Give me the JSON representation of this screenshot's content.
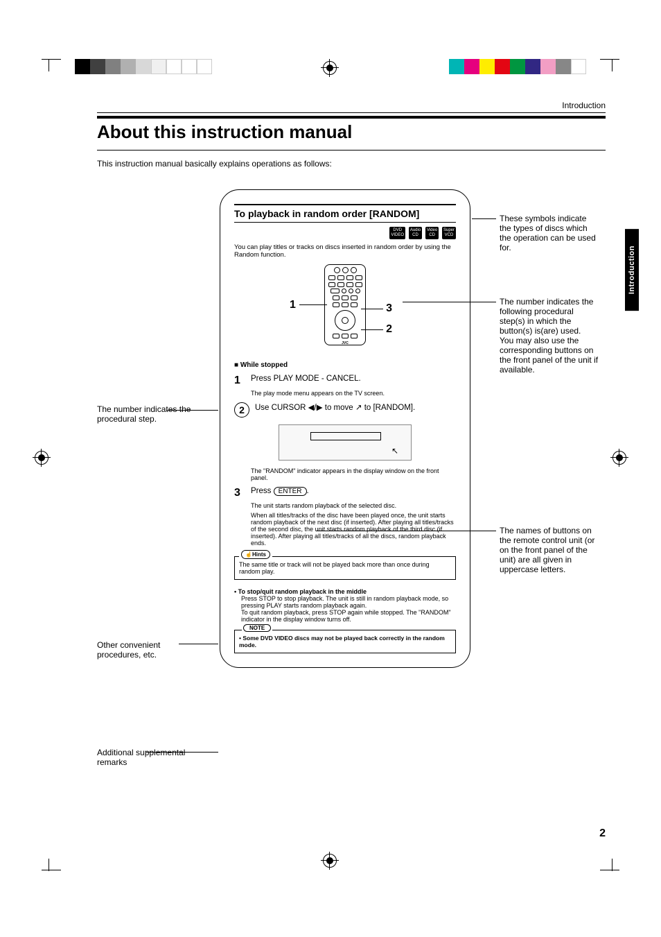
{
  "header": {
    "section": "Introduction"
  },
  "title": "About this instruction manual",
  "intro": "This instruction manual basically explains operations as follows:",
  "side_tab": "Introduction",
  "page_number": "2",
  "example": {
    "title": "To playback in random order [RANDOM]",
    "disc_symbols": [
      "DVD\nVIDEO",
      "Audio\nCD",
      "Video\nCD",
      "Super\nVCD"
    ],
    "desc": "You can play titles or tracks on discs inserted in random order by using the Random function.",
    "remote_brand": "JVC",
    "callouts": {
      "one": "1",
      "two": "2",
      "three": "3"
    },
    "while_stopped": "■ While stopped",
    "step1": {
      "num": "1",
      "text": "Press PLAY MODE - CANCEL.",
      "note": "The play mode menu appears on the TV screen."
    },
    "step2": {
      "num_circled": "2",
      "text_before": "Use CURSOR ◀/▶ to move ",
      "cursor_icon": "↖",
      "text_after": " to [RANDOM].",
      "result": "The \"RANDOM\" indicator appears in the display window on the front panel."
    },
    "step3": {
      "num": "3",
      "press": "Press",
      "button": "ENTER",
      "after": ".",
      "note1": "The unit starts random playback of the selected disc.",
      "note2": "When all titles/tracks of the disc have been played once, the unit starts random playback of the next disc (if inserted). After playing all titles/tracks of the second disc, the unit starts random playback of the third disc (if inserted). After playing all titles/tracks of all the discs, random playback ends."
    },
    "hints": {
      "label_icon": "☝",
      "label": "Hints",
      "text": "The same title or track will not be played back more than once during random play."
    },
    "stop_section": {
      "title": "• To stop/quit random playback in the middle",
      "text": "Press STOP to stop playback. The unit is still in random playback mode, so pressing PLAY starts random playback again.\nTo quit random playback, press STOP again while stopped.  The \"RANDOM\" indicator in the display window turns off."
    },
    "note": {
      "label": "NOTE",
      "text": "• Some DVD VIDEO discs may not be played back correctly in the random mode."
    }
  },
  "annotations": {
    "left": {
      "procedural_step": "The number indicates the procedural step.",
      "other": "Other convenient procedures, etc.",
      "additional": "Additional supplemental remarks"
    },
    "right": {
      "symbols": "These symbols indicate the types of discs which the operation can be used for.",
      "callout_number": "The number indicates the following procedural step(s) in which the button(s) is(are) used.\nYou may also use the corresponding buttons on the front panel of the unit if available.",
      "button_names": "The names of buttons on the remote control unit (or on the front panel of the unit) are all given in uppercase letters."
    }
  }
}
